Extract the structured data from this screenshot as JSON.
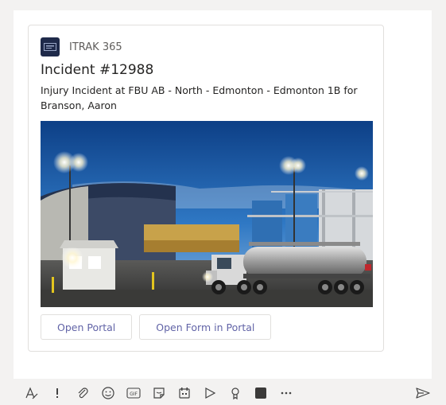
{
  "card": {
    "app_name": "ITRAK 365",
    "title": "Incident #12988",
    "subtitle": "Injury Incident at FBU AB - North - Edmonton - Edmonton 1B for Branson, Aaron",
    "buttons": [
      {
        "label": "Open Portal"
      },
      {
        "label": "Open Form in Portal"
      }
    ]
  },
  "toolbar": {
    "icons": [
      "format-icon",
      "important-icon",
      "attach-icon",
      "emoji-icon",
      "gif-icon",
      "sticker-icon",
      "meeting-icon",
      "stream-icon",
      "praise-icon",
      "app-icon",
      "more-icon"
    ],
    "gif_text": "GIF",
    "more_text": "···"
  },
  "colors": {
    "accent": "#6264a7",
    "logo_bg": "#1f2a4a"
  }
}
